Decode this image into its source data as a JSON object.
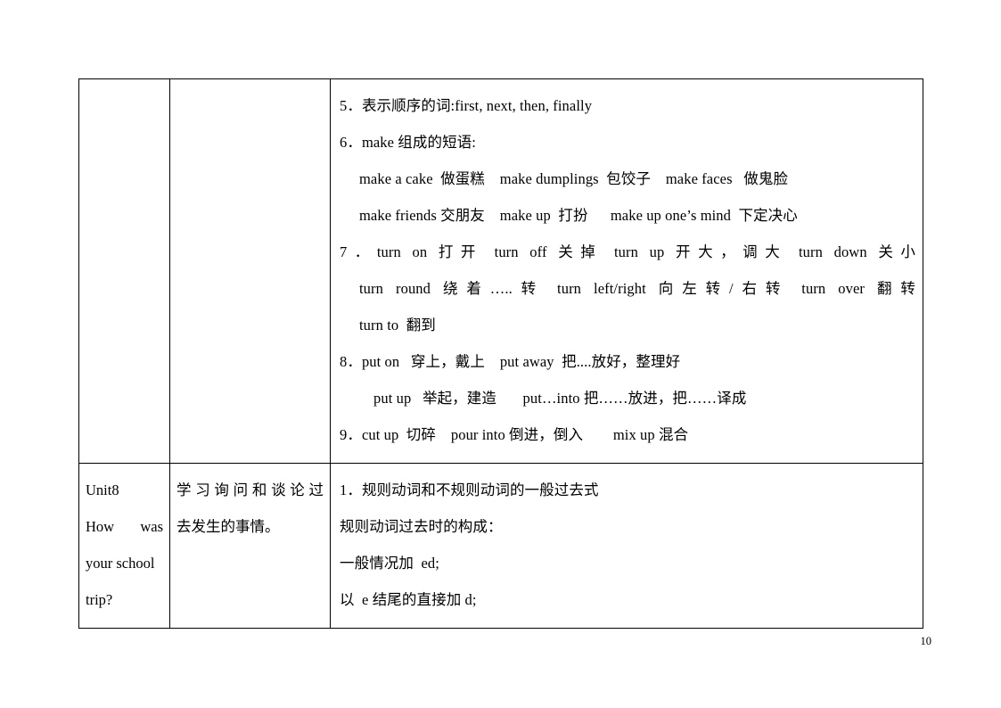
{
  "document": {
    "page_number": "10",
    "table": {
      "rows": [
        {
          "unit": {
            "lines": []
          },
          "aim": {
            "lines": []
          },
          "points": {
            "items": [
              {
                "indent": 0,
                "justify": false,
                "text": "5．表示顺序的词:first, next, then, finally"
              },
              {
                "indent": 0,
                "justify": false,
                "text": "6．make 组成的短语:"
              },
              {
                "indent": 1,
                "justify": false,
                "text": "make a cake  做蛋糕    make dumplings  包饺子    make faces   做鬼脸"
              },
              {
                "indent": 1,
                "justify": false,
                "text": "make friends 交朋友    make up  打扮      make up one’s mind  下定决心"
              },
              {
                "indent": 0,
                "justify": true,
                "text": "7．turn on  打开     turn off  关掉     turn up 开大，调大   turn down   关小"
              },
              {
                "indent": 1,
                "justify": true,
                "text": "turn round 绕着…..转    turn left/right  向左转/右转   turn over 翻转"
              },
              {
                "indent": 1,
                "justify": false,
                "text": "turn to  翻到"
              },
              {
                "indent": 0,
                "justify": false,
                "text": "8．put on   穿上，戴上    put away  把....放好，整理好"
              },
              {
                "indent": 2,
                "justify": false,
                "text": "put up   举起，建造       put…into 把……放进，把……译成"
              },
              {
                "indent": 0,
                "justify": false,
                "text": "9．cut up  切碎    pour into 倒进，倒入        mix up 混合"
              }
            ]
          }
        },
        {
          "unit": {
            "lines": [
              {
                "text": "Unit8",
                "justify": false
              },
              {
                "text": "How was",
                "justify": true
              },
              {
                "text": "your school",
                "justify": false
              },
              {
                "text": "trip?",
                "justify": false
              }
            ]
          },
          "aim": {
            "lines": [
              {
                "text": "学习询问和谈论过",
                "justify": true
              },
              {
                "text": "去发生的事情。",
                "justify": false
              }
            ]
          },
          "points": {
            "items": [
              {
                "indent": 0,
                "justify": false,
                "text": "1．规则动词和不规则动词的一般过去式"
              },
              {
                "indent": 0,
                "justify": false,
                "text": "规则动词过去时的构成："
              },
              {
                "indent": 0,
                "justify": false,
                "text": "一般情况加  ed;"
              },
              {
                "indent": 0,
                "justify": false,
                "text": "以  e 结尾的直接加 d;"
              }
            ]
          }
        }
      ]
    }
  }
}
